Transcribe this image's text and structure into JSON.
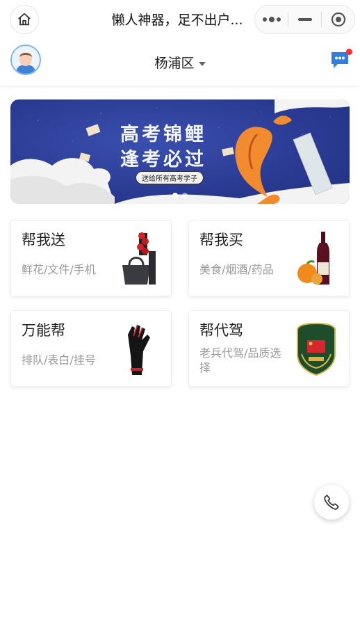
{
  "app": {
    "title": "懒人神器，足不出户...",
    "capsule": {
      "menu_icon": "more-dots-icon",
      "minimize_icon": "minimize-icon",
      "close_icon": "target-circle-icon"
    },
    "home_icon": "home-icon"
  },
  "header": {
    "district": "杨浦区",
    "avatar_icon": "user-avatar",
    "message_icon": "chat-bubble-icon",
    "message_badge_color": "#ff2a2a"
  },
  "banner": {
    "line1": "高考锦鲤",
    "line2": "逢考必过",
    "tag": "送给所有高考学子",
    "background": "#2a3a92",
    "slides": 2,
    "active_slide": 1
  },
  "services": [
    {
      "title": "帮我送",
      "subtitle": "鲜花/文件/手机",
      "image": "flowers-bag-image"
    },
    {
      "title": "帮我买",
      "subtitle": "美食/烟酒/药品",
      "image": "wine-orange-image"
    },
    {
      "title": "万能帮",
      "subtitle": "排队/表白/挂号",
      "image": "gloves-image"
    },
    {
      "title": "帮代驾",
      "subtitle": "老兵代驾/品质选择",
      "image": "veteran-badge-image"
    }
  ],
  "call_button_icon": "phone-icon",
  "colors": {
    "accent": "#2f7fe0",
    "text_primary": "#1f1f1f",
    "text_secondary": "#9a9a9a"
  }
}
